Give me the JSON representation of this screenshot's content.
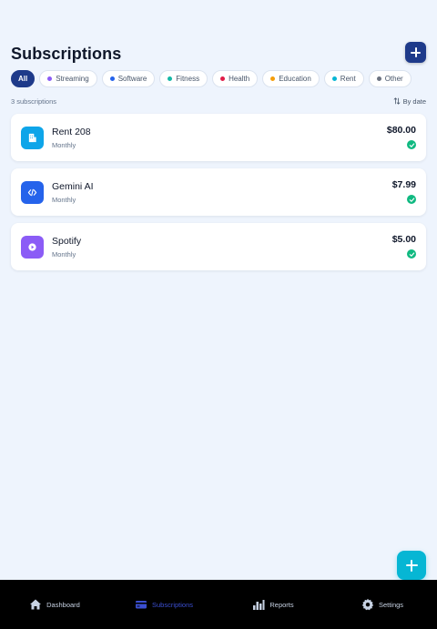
{
  "header": {
    "title": "Subscriptions"
  },
  "filters": [
    {
      "label": "All",
      "active": true,
      "color": ""
    },
    {
      "label": "Streaming",
      "active": false,
      "color": "#8b5cf6"
    },
    {
      "label": "Software",
      "active": false,
      "color": "#2563eb"
    },
    {
      "label": "Fitness",
      "active": false,
      "color": "#14b8a6"
    },
    {
      "label": "Health",
      "active": false,
      "color": "#e11d48"
    },
    {
      "label": "Education",
      "active": false,
      "color": "#f59e0b"
    },
    {
      "label": "Rent",
      "active": false,
      "color": "#06b6d4"
    },
    {
      "label": "Other",
      "active": false,
      "color": "#6b7280"
    }
  ],
  "summary": {
    "count_text": "3 subscriptions",
    "sort_label": "By date"
  },
  "subscriptions": [
    {
      "name": "Rent 208",
      "cycle": "Monthly",
      "price": "$80.00",
      "icon": "building-icon",
      "icon_color": "#0ea5e9"
    },
    {
      "name": "Gemini AI",
      "cycle": "Monthly",
      "price": "$7.99",
      "icon": "code-icon",
      "icon_color": "#2563eb"
    },
    {
      "name": "Spotify",
      "cycle": "Monthly",
      "price": "$5.00",
      "icon": "play-icon",
      "icon_color": "#8b5cf6"
    }
  ],
  "nav": [
    {
      "label": "Dashboard",
      "icon": "home-icon",
      "active": false
    },
    {
      "label": "Subscriptions",
      "icon": "card-icon",
      "active": true
    },
    {
      "label": "Reports",
      "icon": "bar-chart-icon",
      "active": false
    },
    {
      "label": "Settings",
      "icon": "gear-icon",
      "active": false
    }
  ],
  "colors": {
    "accent": "#1e3a8a",
    "fab": "#06b6d4",
    "success": "#10b981",
    "background": "#eef4fd"
  }
}
